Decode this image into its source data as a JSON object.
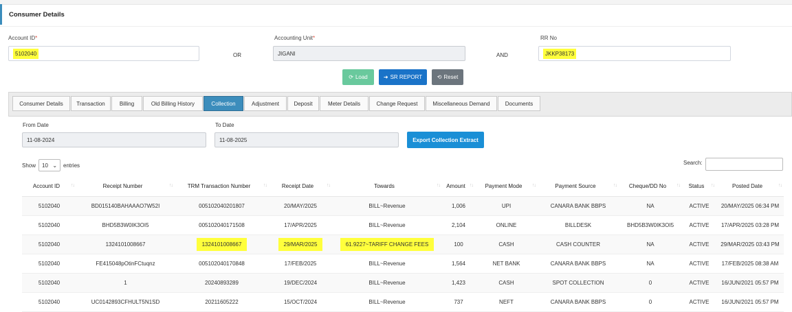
{
  "header": {
    "title": "Consumer Details"
  },
  "form": {
    "account_id": {
      "label": "Account ID",
      "required": "*",
      "value": "5102040"
    },
    "or_text": "OR",
    "accounting_unit": {
      "label": "Accounting Unit",
      "required": "*",
      "value": "JIGANI"
    },
    "and_text": "AND",
    "rr_no": {
      "label": "RR No",
      "value": "JKKP38173"
    }
  },
  "buttons": {
    "load": "Load",
    "sr_report": "SR REPORT",
    "reset": "Reset"
  },
  "tabs": [
    "Consumer Details",
    "Transaction",
    "Billing",
    "Old Billing History",
    "Collection",
    "Adjustment",
    "Deposit",
    "Meter Details",
    "Change Request",
    "Miscellaneous Demand",
    "Documents"
  ],
  "active_tab": "Collection",
  "filters": {
    "from_label": "From Date",
    "from_value": "11-08-2024",
    "to_label": "To Date",
    "to_value": "11-08-2025",
    "export_label": "Export Collection Extract"
  },
  "table_controls": {
    "show": "Show",
    "page_size": "10",
    "entries": "entries",
    "search_label": "Search:"
  },
  "table": {
    "headers": [
      "Account ID",
      "Receipt Number",
      "TRM Transaction Number",
      "Receipt Date",
      "Towards",
      "Amount",
      "Payment Mode",
      "Payment Source",
      "Cheque/DD No",
      "Status",
      "Posted Date"
    ],
    "rows": [
      [
        "5102040",
        "BD015140BAHAAAO7W52I",
        "005102040201807",
        "20/MAY/2025",
        "BILL~Revenue",
        "1,006",
        "UPI",
        "CANARA BANK BBPS",
        "NA",
        "ACTIVE",
        "20/MAY/2025 06:34 PM"
      ],
      [
        "5102040",
        "BHD5B3W0IK3OI5",
        "005102040171508",
        "17/APR/2025",
        "BILL~Revenue",
        "2,104",
        "ONLINE",
        "BILLDESK",
        "BHD5B3W0IK3OI5",
        "ACTIVE",
        "17/APR/2025 03:28 PM"
      ],
      [
        "5102040",
        "1324101008667",
        "1324101008667",
        "29/MAR/2025",
        "61.9227~TARIFF CHANGE FEES",
        "100",
        "CASH",
        "CASH COUNTER",
        "NA",
        "ACTIVE",
        "29/MAR/2025 03:43 PM"
      ],
      [
        "5102040",
        "FE415048pOtinFCtuqnz",
        "005102040170848",
        "17/FEB/2025",
        "BILL~Revenue",
        "1,564",
        "NET BANK",
        "CANARA BANK BBPS",
        "NA",
        "ACTIVE",
        "17/FEB/2025 08:38 AM"
      ],
      [
        "5102040",
        "1",
        "20240893289",
        "19/DEC/2024",
        "BILL~Revenue",
        "1,423",
        "CASH",
        "SPOT COLLECTION",
        "0",
        "ACTIVE",
        "16/JUN/2021 05:57 PM"
      ],
      [
        "5102040",
        "UC0142893CFHULT5N1SD",
        "20211605222",
        "15/OCT/2024",
        "BILL~Revenue",
        "737",
        "NEFT",
        "CANARA BANK BBPS",
        "0",
        "ACTIVE",
        "16/JUN/2021 05:57 PM"
      ]
    ],
    "highlighted": {
      "row": 2,
      "cols": [
        2,
        3,
        4
      ]
    }
  },
  "colors": {
    "highlight": "#ffff3c",
    "active_tab": "#3c8dbc",
    "load_btn": "#4fc08d",
    "sr_btn": "#1a73c8",
    "reset_btn": "#6c757d",
    "export_btn": "#1a8fd6"
  }
}
